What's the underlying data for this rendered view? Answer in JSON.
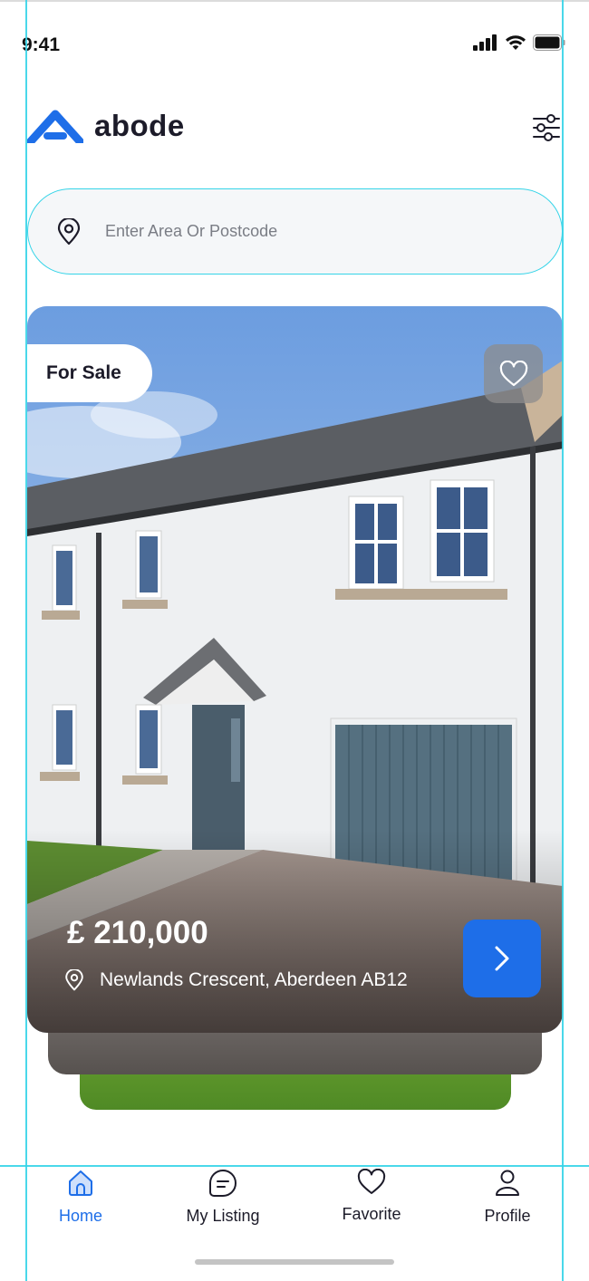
{
  "status_bar": {
    "time": "9:41"
  },
  "brand": {
    "name": "abode",
    "accent": "#1e6ee8"
  },
  "search": {
    "placeholder": "Enter Area Or Postcode"
  },
  "listing": {
    "tag": "For Sale",
    "price": "£ 210,000",
    "address": "Newlands Crescent, Aberdeen AB12"
  },
  "icons": [
    "location-pin-icon",
    "filter-sliders-icon",
    "heart-icon",
    "chevron-right-icon",
    "home-icon",
    "listing-icon",
    "profile-icon"
  ],
  "tabbar": {
    "tabs": [
      {
        "label": "Home",
        "active": true
      },
      {
        "label": "My Listing",
        "active": false
      },
      {
        "label": "Favorite",
        "active": false
      },
      {
        "label": "Profile",
        "active": false
      }
    ]
  }
}
